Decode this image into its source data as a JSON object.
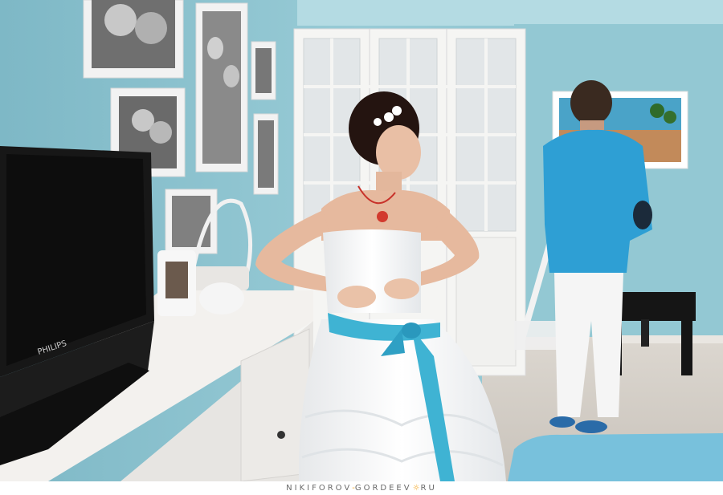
{
  "photo": {
    "subject": "",
    "tv_brand": "PHILIPS",
    "colors": {
      "wall": "#8fc4d0",
      "wall_shadow": "#6fa7b6",
      "ceiling": "#b8dde4",
      "floor": "#d9d3cb",
      "cabinet": "#f4f2ef",
      "sash": "#3fb3d3",
      "jacket": "#2f9fd3",
      "dress": "#f7f7f7",
      "tv": "#151515"
    }
  },
  "watermark": {
    "part1": "NIKIFOROV",
    "separator": "-",
    "part2": "GORDEEV",
    "sun_icon": "☼",
    "part3": "RU"
  }
}
